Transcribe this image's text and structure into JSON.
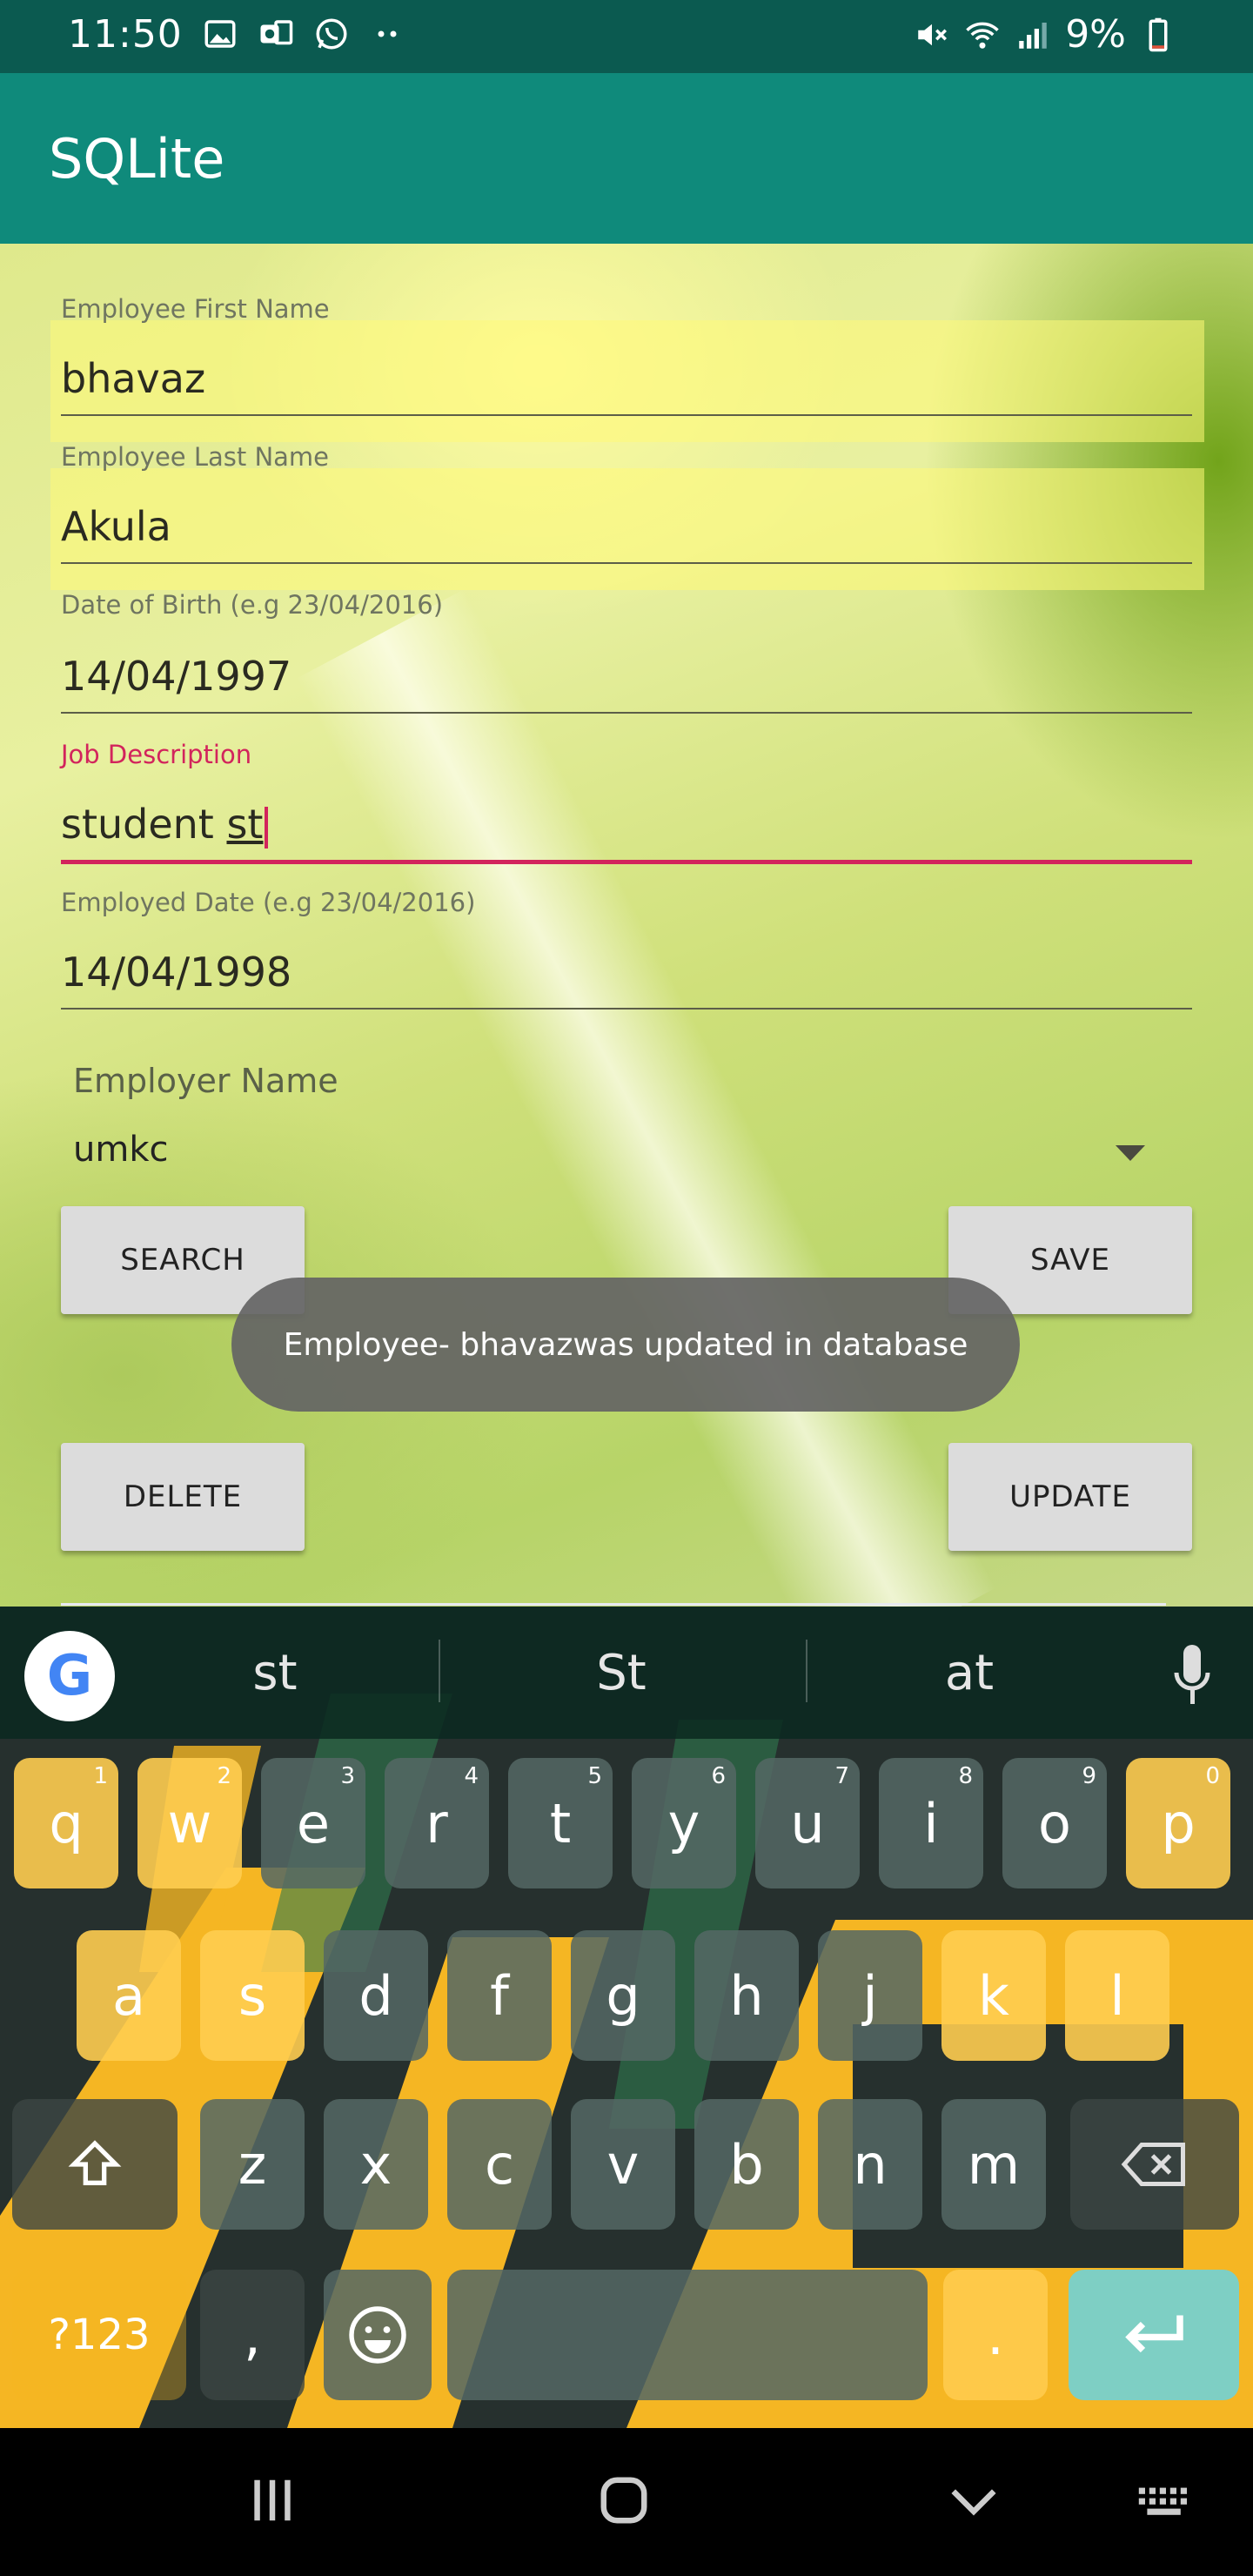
{
  "status_bar": {
    "time": "11:50",
    "battery": "9%"
  },
  "app_bar": {
    "title": "SQLite"
  },
  "form": {
    "first_name": {
      "label": "Employee First Name",
      "value": "bhavaz"
    },
    "last_name": {
      "label": "Employee Last Name",
      "value": "Akula"
    },
    "dob": {
      "label": "Date of Birth (e.g 23/04/2016)",
      "value": "14/04/1997"
    },
    "job": {
      "label": "Job Description",
      "value_prefix": "student ",
      "value_current": "st"
    },
    "employed_date": {
      "label": "Employed Date (e.g 23/04/2016)",
      "value": "14/04/1998"
    },
    "employer": {
      "label": "Employer Name",
      "value": "umkc"
    }
  },
  "buttons": {
    "search": "SEARCH",
    "save": "SAVE",
    "delete": "DELETE",
    "update": "UPDATE"
  },
  "toast": {
    "message": "Employee- bhavazwas updated in database"
  },
  "keyboard": {
    "suggestions": [
      "st",
      "St",
      "at"
    ],
    "row1": [
      {
        "k": "q",
        "n": "1"
      },
      {
        "k": "w",
        "n": "2"
      },
      {
        "k": "e",
        "n": "3"
      },
      {
        "k": "r",
        "n": "4"
      },
      {
        "k": "t",
        "n": "5"
      },
      {
        "k": "y",
        "n": "6"
      },
      {
        "k": "u",
        "n": "7"
      },
      {
        "k": "i",
        "n": "8"
      },
      {
        "k": "o",
        "n": "9"
      },
      {
        "k": "p",
        "n": "0"
      }
    ],
    "row2": [
      "a",
      "s",
      "d",
      "f",
      "g",
      "h",
      "j",
      "k",
      "l"
    ],
    "row3": [
      "z",
      "x",
      "c",
      "v",
      "b",
      "n",
      "m"
    ],
    "symbols_label": "?123",
    "comma": ",",
    "period": "."
  },
  "colors": {
    "app_bar": "#0f8a7b",
    "status_bar": "#0b5a50",
    "accent": "#d2245c",
    "toast_bg": "#646464",
    "enter_key": "#7ecfc4"
  }
}
